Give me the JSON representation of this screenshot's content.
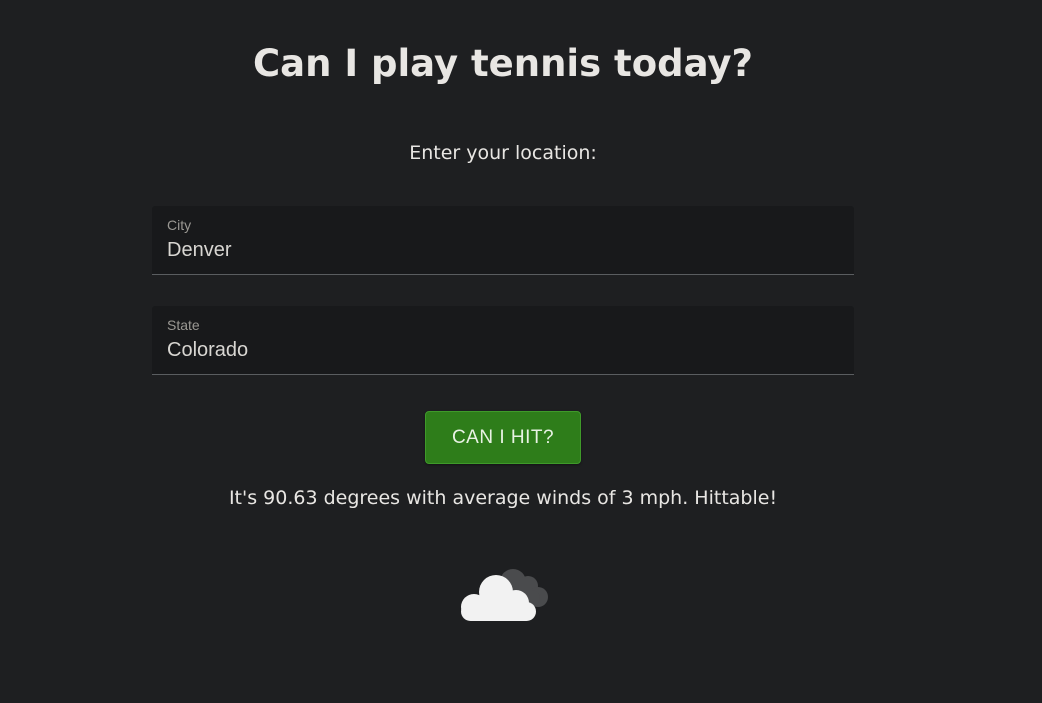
{
  "header": {
    "title": "Can I play tennis today?",
    "prompt": "Enter your location:"
  },
  "form": {
    "city": {
      "label": "City",
      "value": "Denver"
    },
    "state": {
      "label": "State",
      "value": "Colorado"
    },
    "submit_label": "CAN I HIT?"
  },
  "result": {
    "message": "It's 90.63 degrees with average winds of 3 mph. Hittable!",
    "icon": "cloudy-icon"
  },
  "colors": {
    "background": "#1e1f21",
    "button": "#2e7d1a",
    "field_background": "#18191b"
  }
}
